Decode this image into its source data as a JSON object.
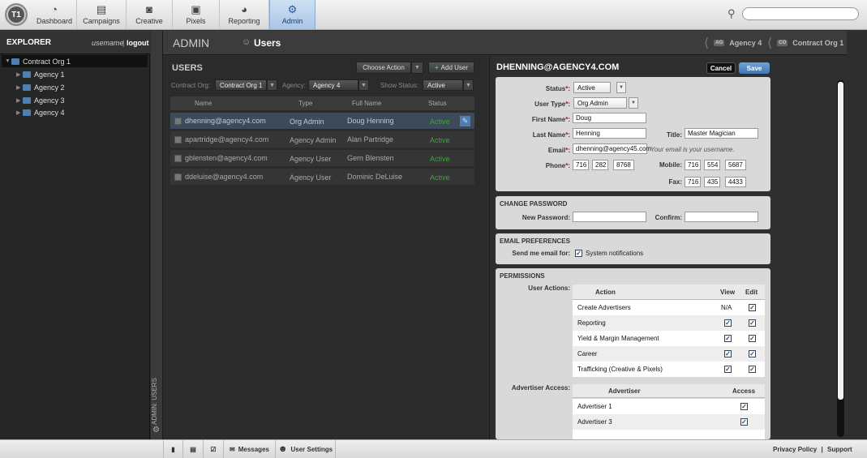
{
  "logo_text": "T1",
  "nav": {
    "tabs": [
      {
        "label": "Dashboard",
        "icon": "dashboard-icon",
        "glyph": "◔"
      },
      {
        "label": "Campaigns",
        "icon": "campaigns-icon",
        "glyph": "▤"
      },
      {
        "label": "Creative",
        "icon": "creative-icon",
        "glyph": "◙"
      },
      {
        "label": "Pixels",
        "icon": "pixels-icon",
        "glyph": "▣"
      },
      {
        "label": "Reporting",
        "icon": "reporting-icon",
        "glyph": "◕"
      },
      {
        "label": "Admin",
        "icon": "gear-icon",
        "glyph": "⚙"
      }
    ],
    "active": "Admin",
    "search_placeholder": ""
  },
  "explorer": {
    "title": "EXPLORER",
    "username": "usemame",
    "separator": "|",
    "logout": "logout",
    "tree": [
      {
        "label": "Contract Org 1",
        "level": 0,
        "selected": true
      },
      {
        "label": "Agency 1",
        "level": 1
      },
      {
        "label": "Agency 2",
        "level": 1
      },
      {
        "label": "Agency 3",
        "level": 1
      },
      {
        "label": "Agency 4",
        "level": 1
      }
    ]
  },
  "side_strip_label": "ADMIN: USERS",
  "header": {
    "title": "ADMIN",
    "section": "Users",
    "crumbs": [
      {
        "badge": "AG",
        "label": "Agency 4"
      },
      {
        "badge": "CO",
        "label": "Contract Org 1"
      }
    ]
  },
  "users": {
    "title": "USERS",
    "choose_action": "Choose Action",
    "add_user": "Add User",
    "filters": {
      "contract_org_label": "Contract Org:",
      "contract_org_value": "Contract Org 1",
      "agency_label": "Agency:",
      "agency_value": "Agency 4",
      "status_label": "Show Status:",
      "status_value": "Active"
    },
    "columns": [
      "Name",
      "Type",
      "Full Name",
      "Status"
    ],
    "rows": [
      {
        "name": "dhenning@agency4.com",
        "type": "Org Admin",
        "full_name": "Doug Henning",
        "status": "Active"
      },
      {
        "name": "apartridge@agency4.com",
        "type": "Agency Admin",
        "full_name": "Alan Partridge",
        "status": "Active"
      },
      {
        "name": "gblensten@agency4.com",
        "type": "Agency User",
        "full_name": "Gern Blensten",
        "status": "Active"
      },
      {
        "name": "ddeluise@agency4.com",
        "type": "Agency User",
        "full_name": "Dominic DeLuise",
        "status": "Active"
      }
    ]
  },
  "detail": {
    "title": "DHENNING@AGENCY4.COM",
    "cancel": "Cancel",
    "save": "Save",
    "labels": {
      "status": "Status",
      "user_type": "User Type",
      "first_name": "First Name",
      "last_name": "Last Name",
      "title": "Title:",
      "email": "Email",
      "phone": "Phone",
      "mobile": "Mobile:",
      "fax": "Fax:"
    },
    "values": {
      "status": "Active",
      "user_type": "Org Admin",
      "first_name": "Doug",
      "last_name": "Henning",
      "title": "Master Magician",
      "email": "dhenning@agency45.com",
      "email_hint": "Your email is your username.",
      "phone": [
        "716",
        "282",
        "8768"
      ],
      "mobile": [
        "716",
        "554",
        "5687"
      ],
      "fax": [
        "716",
        "435",
        "4433"
      ]
    },
    "change_password": {
      "section": "CHANGE PASSWORD",
      "new_password": "New Password:",
      "confirm": "Confirm:"
    },
    "email_prefs": {
      "section": "EMAIL PREFERENCES",
      "send_label": "Send me email for:",
      "option": "System notifications"
    },
    "permissions": {
      "section": "PERMISSIONS",
      "user_actions_label": "User Actions:",
      "columns": [
        "Action",
        "View",
        "Edit"
      ],
      "actions": [
        {
          "action": "Create Advertisers",
          "view": "N/A",
          "edit": true
        },
        {
          "action": "Reporting",
          "view": true,
          "edit": true
        },
        {
          "action": "Yield & Margin Management",
          "view": true,
          "edit": true
        },
        {
          "action": "Career",
          "view": true,
          "edit": true
        },
        {
          "action": "Trafficking (Creative & Pixels)",
          "view": true,
          "edit": true
        }
      ],
      "advertiser_access_label": "Advertiser Access:",
      "adv_columns": [
        "Advertiser",
        "Access"
      ],
      "advertisers": [
        {
          "name": "Advertiser 1",
          "access": true
        },
        {
          "name": "Advertiser 3",
          "access": true
        }
      ]
    }
  },
  "footer": {
    "messages": "Messages",
    "user_settings": "User Settings",
    "privacy": "Privacy Policy",
    "support": "Support",
    "separator": "|"
  }
}
